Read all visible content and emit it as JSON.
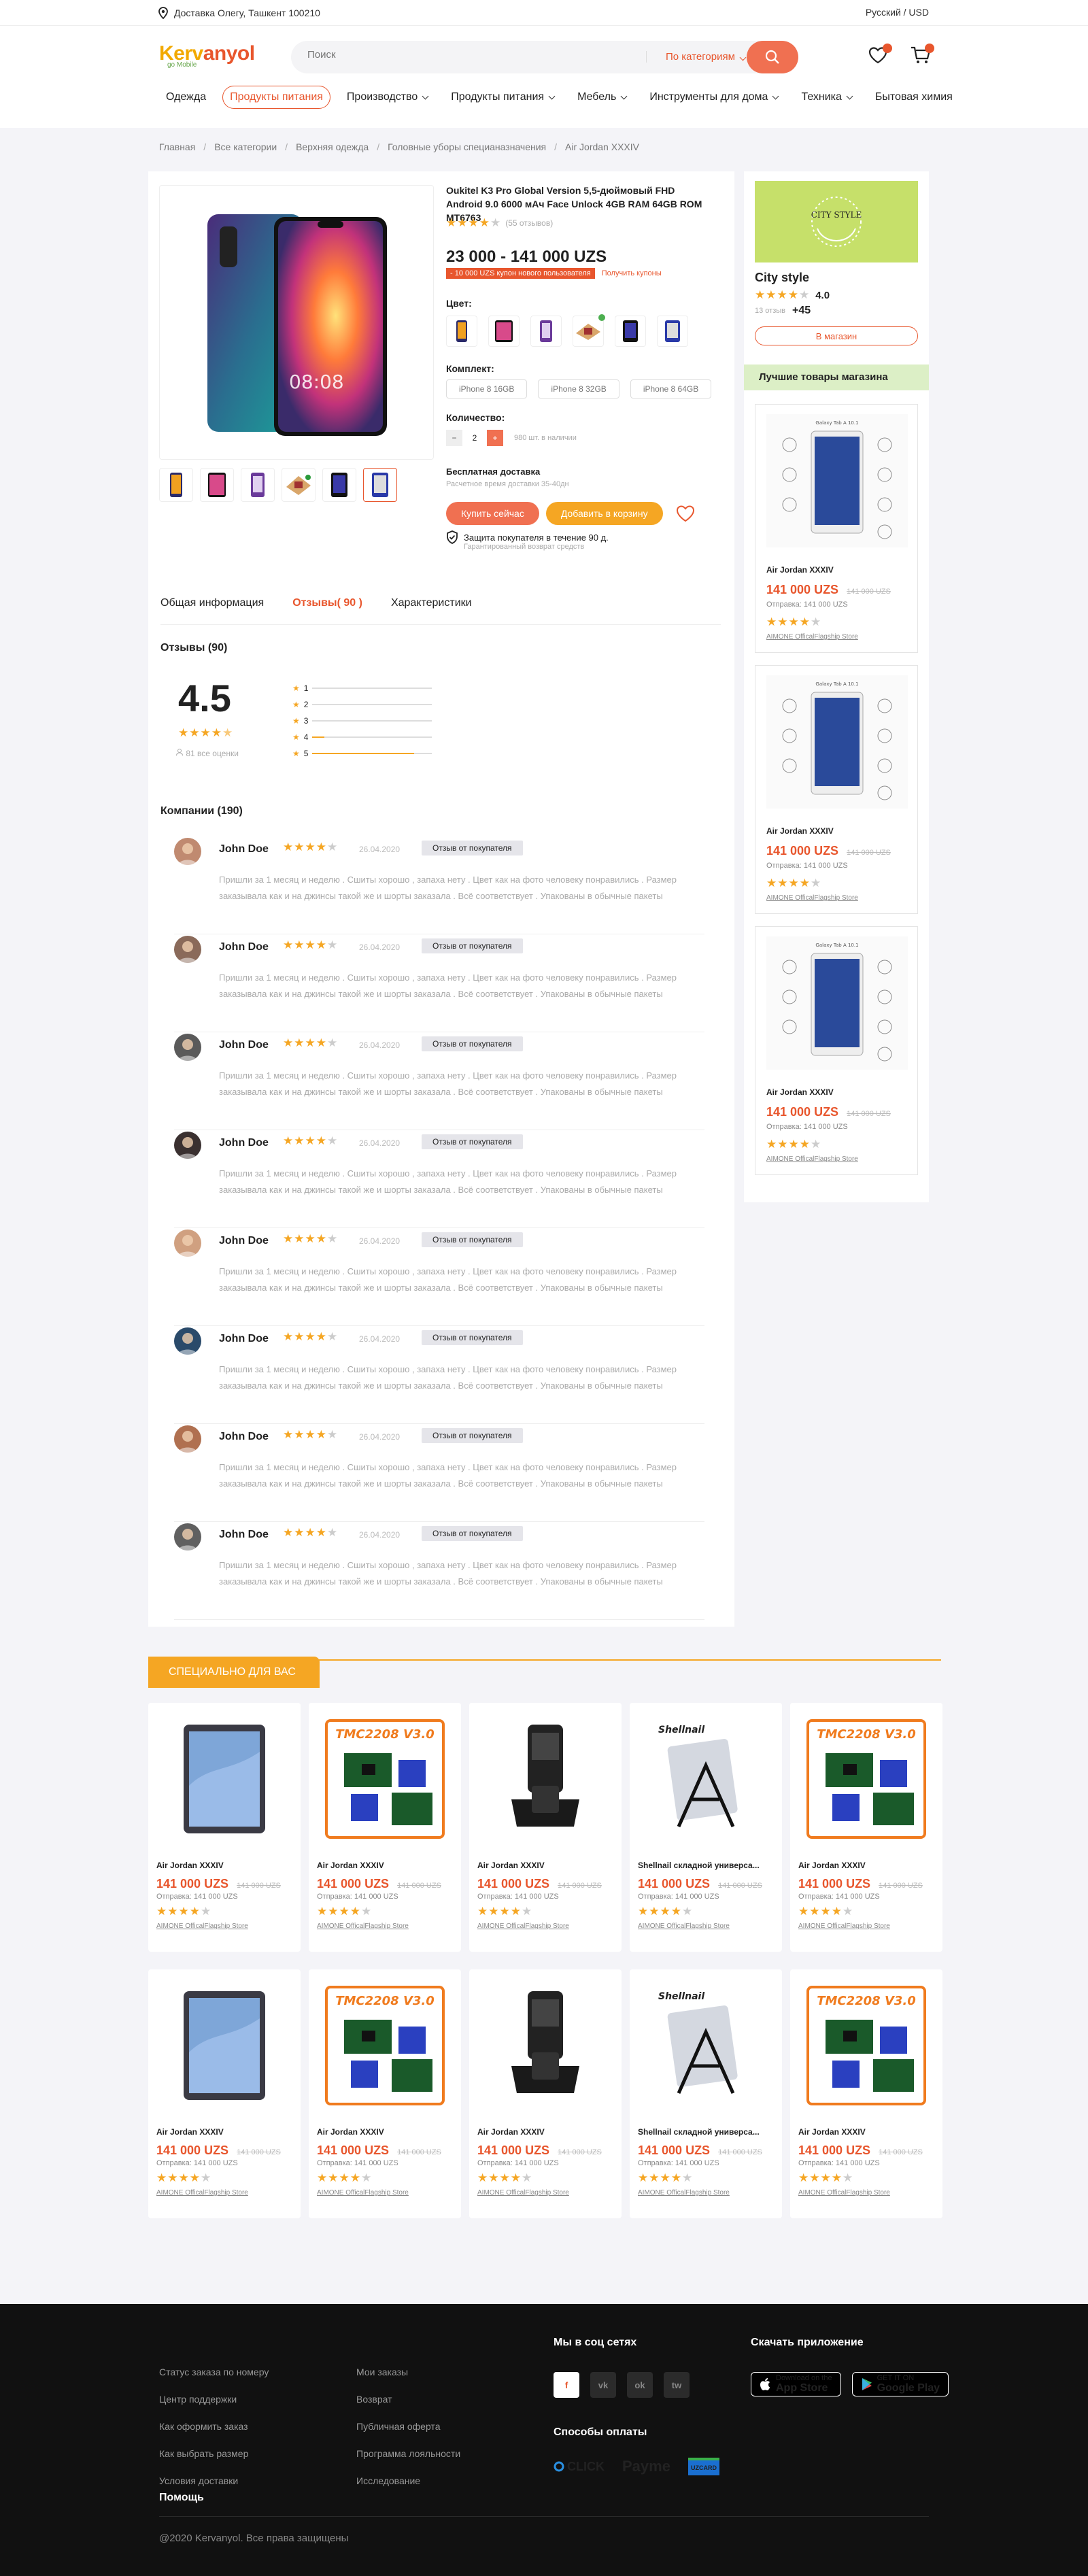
{
  "topbar": {
    "location": "Доставка Олегу, Ташкент 100210",
    "lang": "Русский / USD"
  },
  "logo": {
    "text1": "Kerv",
    "text2": "anyol",
    "sub": "go Mobile"
  },
  "search": {
    "placeholder": "Поиск",
    "category": "По категориям"
  },
  "nav": [
    {
      "label": "Одежда"
    },
    {
      "label": "Продукты питания"
    },
    {
      "label": "Производство"
    },
    {
      "label": "Продукты питания"
    },
    {
      "label": "Мебель"
    },
    {
      "label": "Инструменты для дома"
    },
    {
      "label": "Техника"
    },
    {
      "label": "Бытовая химия"
    }
  ],
  "breadcrumbs": [
    "Главная",
    "Все категории",
    "Верхняя одежда",
    "Головные уборы специаназначения",
    "Air Jordan XXXIV"
  ],
  "product": {
    "title": "Oukitel K3 Pro Global Version 5,5-дюймовый FHD Android 9.0 6000 мАч Face Unlock 4GB RAM 64GB ROM MT6763",
    "reviews_count": "(55 отзывов)",
    "price": "23 000 - 141 000 UZS",
    "discount": "- 10 000 UZS купон нового пользователя",
    "discount_link": "Получить купоны",
    "color_label": "Цвет:",
    "kit_label": "Комплект:",
    "kits": [
      "iPhone 8 16GB",
      "iPhone 8 32GB",
      "iPhone 8 64GB"
    ],
    "qty_label": "Количество:",
    "qty_value": "2",
    "qty_stock": "980 шт. в наличии",
    "delivery_title": "Бесплатная доставка",
    "delivery_sub": "Расчетное время доставки 35-40дн",
    "buy_now": "Купить сейчас",
    "add_cart": "Добавить в корзину",
    "protect_title": "Защита покупателя в течение 90 д.",
    "protect_sub": "Гарантированный возврат средств"
  },
  "tabs": [
    "Общая информация",
    "Отзывы( 90 )",
    "Характеристики"
  ],
  "reviews": {
    "title": "Отзывы (90)",
    "score": "4.5",
    "count": "81 все оценки",
    "bars": [
      {
        "label": "1",
        "fill": 0
      },
      {
        "label": "2",
        "fill": 0
      },
      {
        "label": "3",
        "fill": 0
      },
      {
        "label": "4",
        "fill": 0.1
      },
      {
        "label": "5",
        "fill": 0.85
      }
    ]
  },
  "companies": {
    "title": "Компании (190)",
    "items": [
      {
        "name": "John Doe",
        "date": "26.04.2020",
        "tag": "Отзыв от покупателя",
        "text": "Пришли за 1 месяц и неделю . Сшиты хорошо , запаха нету . Цвет как на фото человеку понравились . Размер заказывала как и на джинсы такой же и шорты заказала . Всё соответствует . Упакованы в обычные пакеты"
      },
      {
        "name": "John Doe",
        "date": "26.04.2020",
        "tag": "Отзыв от покупателя",
        "text": "Пришли за 1 месяц и неделю . Сшиты хорошо , запаха нету . Цвет как на фото человеку понравились . Размер заказывала как и на джинсы такой же и шорты заказала . Всё соответствует . Упакованы в обычные пакеты"
      },
      {
        "name": "John Doe",
        "date": "26.04.2020",
        "tag": "Отзыв от покупателя",
        "text": "Пришли за 1 месяц и неделю . Сшиты хорошо , запаха нету . Цвет как на фото человеку понравились . Размер заказывала как и на джинсы такой же и шорты заказала . Всё соответствует . Упакованы в обычные пакеты"
      },
      {
        "name": "John Doe",
        "date": "26.04.2020",
        "tag": "Отзыв от покупателя",
        "text": "Пришли за 1 месяц и неделю . Сшиты хорошо , запаха нету . Цвет как на фото человеку понравились . Размер заказывала как и на джинсы такой же и шорты заказала . Всё соответствует . Упакованы в обычные пакеты"
      },
      {
        "name": "John Doe",
        "date": "26.04.2020",
        "tag": "Отзыв от покупателя",
        "text": "Пришли за 1 месяц и неделю . Сшиты хорошо , запаха нету . Цвет как на фото человеку понравились . Размер заказывала как и на джинсы такой же и шорты заказала . Всё соответствует . Упакованы в обычные пакеты"
      },
      {
        "name": "John Doe",
        "date": "26.04.2020",
        "tag": "Отзыв от покупателя",
        "text": "Пришли за 1 месяц и неделю . Сшиты хорошо , запаха нету . Цвет как на фото человеку понравились . Размер заказывала как и на джинсы такой же и шорты заказала . Всё соответствует . Упакованы в обычные пакеты"
      },
      {
        "name": "John Doe",
        "date": "26.04.2020",
        "tag": "Отзыв от покупателя",
        "text": "Пришли за 1 месяц и неделю . Сшиты хорошо , запаха нету . Цвет как на фото человеку понравились . Размер заказывала как и на джинсы такой же и шорты заказала . Всё соответствует . Упакованы в обычные пакеты"
      },
      {
        "name": "John Doe",
        "date": "26.04.2020",
        "tag": "Отзыв от покупателя",
        "text": "Пришли за 1 месяц и неделю . Сшиты хорошо , запаха нету . Цвет как на фото человеку понравились . Размер заказывала как и на джинсы такой же и шорты заказала . Всё соответствует . Упакованы в обычные пакеты"
      }
    ]
  },
  "store": {
    "logo_text": "CITY STYLE",
    "name": "City style",
    "rating": "4.0",
    "reviews_label": "13 отзыв",
    "reviews_plus": "+45",
    "button": "В магазин",
    "best_title": "Лучшие товары магазина"
  },
  "side_products": [
    {
      "name": "Air Jordan XXXIV",
      "price": "141 000 UZS",
      "old": "141 000 UZS",
      "ship": "Отправка: 141 000 UZS",
      "store": "AIMONE OfficalFlagship Store"
    },
    {
      "name": "Air Jordan XXXIV",
      "price": "141 000 UZS",
      "old": "141 000 UZS",
      "ship": "Отправка: 141 000 UZS",
      "store": "AIMONE OfficalFlagship Store"
    },
    {
      "name": "Air Jordan XXXIV",
      "price": "141 000 UZS",
      "old": "141 000 UZS",
      "ship": "Отправка: 141 000 UZS",
      "store": "AIMONE OfficalFlagship Store"
    }
  ],
  "special": {
    "title": "СПЕЦИАЛЬНО ДЛЯ ВАС"
  },
  "grid": [
    {
      "name": "Air Jordan XXXIV",
      "kind": "tablet",
      "price": "141 000 UZS",
      "old": "141 000 UZS",
      "ship": "Отправка: 141 000 UZS",
      "store": "AIMONE OfficalFlagship Store"
    },
    {
      "name": "Air Jordan XXXIV",
      "kind": "tmc",
      "price": "141 000 UZS",
      "old": "141 000 UZS",
      "ship": "Отправка: 141 000 UZS",
      "store": "AIMONE OfficalFlagship Store"
    },
    {
      "name": "Air Jordan XXXIV",
      "kind": "scanner",
      "price": "141 000 UZS",
      "old": "141 000 UZS",
      "ship": "Отправка: 141 000 UZS",
      "store": "AIMONE OfficalFlagship Store"
    },
    {
      "name": "Shellnail складной универса...",
      "kind": "stand",
      "price": "141 000 UZS",
      "old": "141 000 UZS",
      "ship": "Отправка: 141 000 UZS",
      "store": "AIMONE OfficalFlagship Store"
    },
    {
      "name": "Air Jordan XXXIV",
      "kind": "tmc",
      "price": "141 000 UZS",
      "old": "141 000 UZS",
      "ship": "Отправка: 141 000 UZS",
      "store": "AIMONE OfficalFlagship Store"
    },
    {
      "name": "Air Jordan XXXIV",
      "kind": "tablet",
      "price": "141 000 UZS",
      "old": "141 000 UZS",
      "ship": "Отправка: 141 000 UZS",
      "store": "AIMONE OfficalFlagship Store"
    },
    {
      "name": "Air Jordan XXXIV",
      "kind": "tmc",
      "price": "141 000 UZS",
      "old": "141 000 UZS",
      "ship": "Отправка: 141 000 UZS",
      "store": "AIMONE OfficalFlagship Store"
    },
    {
      "name": "Air Jordan XXXIV",
      "kind": "scanner",
      "price": "141 000 UZS",
      "old": "141 000 UZS",
      "ship": "Отправка: 141 000 UZS",
      "store": "AIMONE OfficalFlagship Store"
    },
    {
      "name": "Shellnail складной универса...",
      "kind": "stand",
      "price": "141 000 UZS",
      "old": "141 000 UZS",
      "ship": "Отправка: 141 000 UZS",
      "store": "AIMONE OfficalFlagship Store"
    },
    {
      "name": "Air Jordan XXXIV",
      "kind": "tmc",
      "price": "141 000 UZS",
      "old": "141 000 UZS",
      "ship": "Отправка: 141 000 UZS",
      "store": "AIMONE OfficalFlagship Store"
    }
  ],
  "footer": {
    "col1": [
      "Статус заказа по номеру",
      "Центр поддержки",
      "Как оформить заказ",
      "Как выбрать размер",
      "Условия доставки"
    ],
    "col1_title": "Помощь",
    "col2": [
      "Мои заказы",
      "Возврат",
      "Публичная оферта",
      "Программа лояльности",
      "Исследование"
    ],
    "social_title": "Мы в соц сетях",
    "social": [
      "f",
      "vk",
      "ok",
      "tw"
    ],
    "pay_title": "Способы оплаты",
    "pay": [
      "CLICK",
      "Payme",
      "UZCARD"
    ],
    "app_title": "Скачать приложение",
    "appstore_small": "Download on the",
    "appstore": "App Store",
    "gplay_small": "GET IT ON",
    "gplay": "Google Play",
    "copyright": "@2020 Kervanyol. Все права защищены"
  },
  "colors": {
    "accent": "#e8562d",
    "star": "#f5a623",
    "green": "#c6e06a"
  }
}
